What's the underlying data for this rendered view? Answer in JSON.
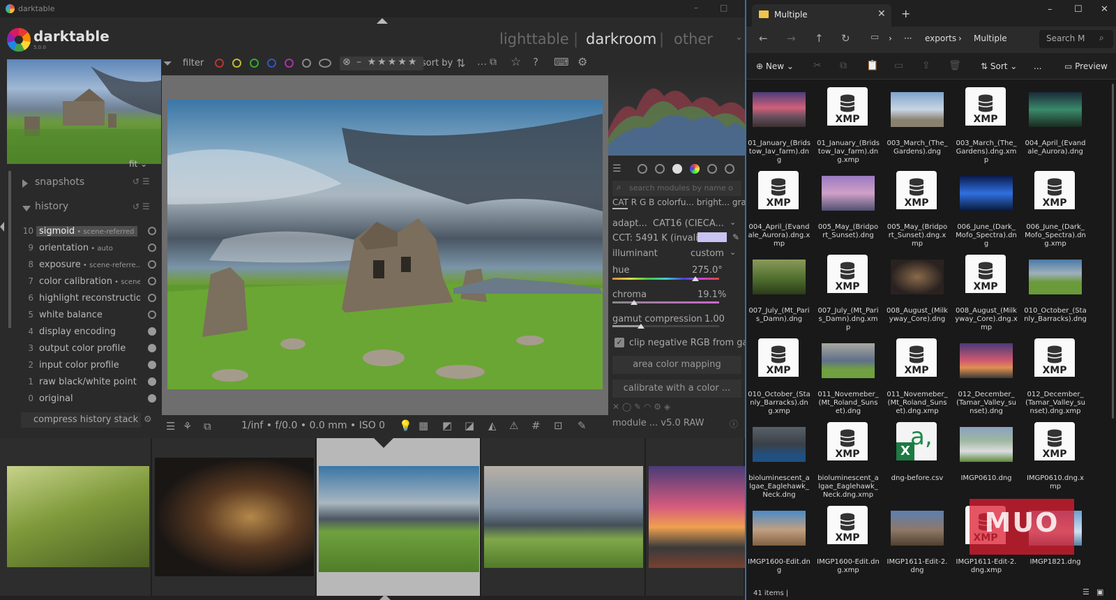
{
  "darktable": {
    "window_title": "darktable",
    "app_name": "darktable",
    "version": "5.0.0",
    "views": [
      "lighttable",
      "darkroom",
      "other"
    ],
    "active_view": "darkroom",
    "fit_label": "fit",
    "snapshots_label": "snapshots",
    "history_label": "history",
    "history": [
      {
        "n": "10",
        "name": "sigmoid",
        "sub": "scene-referred ...",
        "selected": true,
        "power": "ring"
      },
      {
        "n": "9",
        "name": "orientation",
        "sub": "auto",
        "power": "ring"
      },
      {
        "n": "8",
        "name": "exposure",
        "sub": "scene-referre...",
        "power": "ring"
      },
      {
        "n": "7",
        "name": "color calibration",
        "sub": "scene...",
        "power": "ring"
      },
      {
        "n": "6",
        "name": "highlight reconstruction",
        "sub": "",
        "power": "ring"
      },
      {
        "n": "5",
        "name": "white balance",
        "sub": "",
        "power": "ring"
      },
      {
        "n": "4",
        "name": "display encoding",
        "sub": "",
        "power": "filled"
      },
      {
        "n": "3",
        "name": "output color profile",
        "sub": "",
        "power": "filled"
      },
      {
        "n": "2",
        "name": "input color profile",
        "sub": "",
        "power": "filled"
      },
      {
        "n": "1",
        "name": "raw black/white point ...",
        "sub": "",
        "power": "filled"
      },
      {
        "n": "0",
        "name": "original",
        "sub": "",
        "power": "filled"
      }
    ],
    "compress_label": "compress history stack",
    "filter_label": "filter",
    "rating_text": "⊗ – ★★★★★",
    "sort_label": "sort by",
    "exif_line": "1/inf • f/0.0 • 0.0 mm • ISO 0",
    "module_search_placeholder": "search modules by name o",
    "module_tabs": "CAT   R G B   colorfu...   bright...   gray",
    "adaptation_label": "adapt...",
    "adaptation_value": "CAT16 (CIECA...",
    "cct_label": "CCT: 5491 K (invalid)",
    "illuminant_label": "illuminant",
    "illuminant_value": "custom",
    "hue_label": "hue",
    "hue_value": "275.0°",
    "chroma_label": "chroma",
    "chroma_value": "19.1%",
    "gamut_label": "gamut compression",
    "gamut_value": "1.00",
    "clip_label": "clip negative RGB from ga...",
    "area_btn": "area color mapping",
    "calibrate_btn": "calibrate with a color ...",
    "module_status": "module ... v5.0 RAW",
    "colors": {
      "accent": "#b8b8b8",
      "swatch": "#c8c3f2"
    }
  },
  "explorer": {
    "tab_title": "Multiple",
    "breadcrumb": [
      "exports",
      "Multiple"
    ],
    "search_placeholder": "Search M",
    "cmd_new": "New",
    "cmd_sort": "Sort",
    "cmd_more": "...",
    "cmd_preview": "Preview",
    "items": [
      {
        "name": "01_January_(Bridstow_lav_farm).dng",
        "kind": "photo",
        "theme": "sunset"
      },
      {
        "name": "01_January_(Bridstow_lav_farm).dng.xmp",
        "kind": "xmp"
      },
      {
        "name": "003_March_(The_Gardens).dng",
        "kind": "photo",
        "theme": "beach"
      },
      {
        "name": "003_March_(The_Gardens).dng.xmp",
        "kind": "xmp"
      },
      {
        "name": "004_April_(Evandale_Aurora).dng",
        "kind": "photo",
        "theme": "aurora"
      },
      {
        "name": "004_April_(Evandale_Aurora).dng.xmp",
        "kind": "xmp"
      },
      {
        "name": "005_May_(Bridport_Sunset).dng",
        "kind": "photo",
        "theme": "pink"
      },
      {
        "name": "005_May_(Bridport_Sunset).dng.xmp",
        "kind": "xmp"
      },
      {
        "name": "006_June_(Dark_Mofo_Spectra).dng",
        "kind": "photo",
        "theme": "spectra"
      },
      {
        "name": "006_June_(Dark_Mofo_Spectra).dng.xmp",
        "kind": "xmp"
      },
      {
        "name": "007_July_(Mt_Paris_Damn).dng",
        "kind": "photo",
        "theme": "forest"
      },
      {
        "name": "007_July_(Mt_Paris_Damn).dng.xmp",
        "kind": "xmp"
      },
      {
        "name": "008_August_(Milkyway_Core).dng",
        "kind": "photo",
        "theme": "milky"
      },
      {
        "name": "008_August_(Milkyway_Core).dng.xmp",
        "kind": "xmp"
      },
      {
        "name": "010_October_(Stanly_Barracks).dng",
        "kind": "photo",
        "theme": "ruin"
      },
      {
        "name": "010_October_(Stanly_Barracks).dng.xmp",
        "kind": "xmp"
      },
      {
        "name": "011_Novemeber_(Mt_Roland_Sunset).dng",
        "kind": "photo",
        "theme": "lake"
      },
      {
        "name": "011_Novemeber_(Mt_Roland_Sunset).dng.xmp",
        "kind": "xmp"
      },
      {
        "name": "012_December_(Tamar_Valley_sunset).dng",
        "kind": "photo",
        "theme": "redsky"
      },
      {
        "name": "012_December_(Tamar_Valley_sunset).dng.xmp",
        "kind": "xmp"
      },
      {
        "name": "bioluminescent_algae_Eaglehawk_Neck.dng",
        "kind": "photo",
        "theme": "storm"
      },
      {
        "name": "bioluminescent_algae_Eaglehawk_Neck.dng.xmp",
        "kind": "xmp"
      },
      {
        "name": "dng-before.csv",
        "kind": "csv"
      },
      {
        "name": "IMGP0610.dng",
        "kind": "photo",
        "theme": "flowers"
      },
      {
        "name": "IMGP0610.dng.xmp",
        "kind": "xmp"
      },
      {
        "name": "IMGP1600-Edit.dng",
        "kind": "photo",
        "theme": "rocks"
      },
      {
        "name": "IMGP1600-Edit.dng.xmp",
        "kind": "xmp"
      },
      {
        "name": "IMGP1611-Edit-2.dng",
        "kind": "photo",
        "theme": "rocks2"
      },
      {
        "name": "IMGP1611-Edit-2.dng.xmp",
        "kind": "xmp"
      },
      {
        "name": "IMGP1821.dng",
        "kind": "photo",
        "theme": "pier"
      }
    ],
    "status": "41 items  |",
    "watermark": "MUO"
  }
}
